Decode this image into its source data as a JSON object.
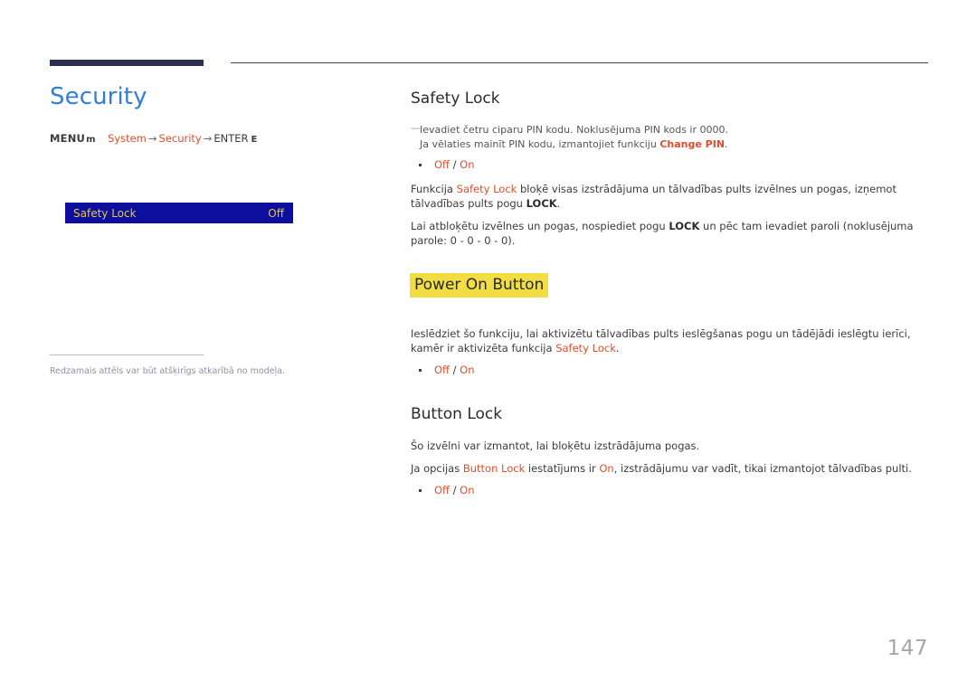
{
  "page": {
    "number": "147",
    "title": "Security",
    "accent_color": "#e24d2c",
    "title_color": "#2f7fd8",
    "highlight_color": "#f2dd43",
    "rule_color": "#2b3050"
  },
  "menu_path": {
    "menu_label": "MENU",
    "menu_glyph": "m",
    "step1": "System",
    "arrow1": "→",
    "step2": "Security",
    "arrow2": "→",
    "enter_label": "ENTER",
    "enter_glyph": "E"
  },
  "osd_preview": {
    "label": "Safety Lock",
    "value": "Off",
    "background": "#0d0d9e",
    "text_color": "#e8c93a"
  },
  "left_footnote": {
    "text": "Redzamais attēls var būt atšķirīgs atkarībā no modeļa."
  },
  "sections": [
    {
      "heading": "Safety Lock",
      "highlighted": false,
      "note": {
        "dash": "—",
        "line1_a": "Ievadiet četru ciparu PIN kodu. Noklusējuma PIN kods ir 0000.",
        "line2_a": "Ja vēlaties mainīt PIN kodu, izmantojiet funkciju ",
        "line2_accent": "Change PIN",
        "line2_b": "."
      },
      "options": {
        "off": "Off",
        "slash": " / ",
        "on": "On"
      },
      "paragraphs": [
        {
          "p1_a": "Funkcija ",
          "p1_accent": "Safety Lock",
          "p1_b": " bloķē visas izstrādājuma un tālvadības pults izvēlnes un pogas, izņemot tālvadības pults pogu ",
          "p1_bold": "LOCK",
          "p1_c": "."
        },
        {
          "p2_a": "Lai atbloķētu izvēlnes un pogas, nospiediet pogu ",
          "p2_bold": "LOCK",
          "p2_b": " un pēc tam ievadiet paroli (noklusējuma parole: 0 - 0 - 0 - 0)."
        }
      ]
    },
    {
      "heading": "Power On Button",
      "highlighted": true,
      "paragraph": {
        "a": "Ieslēdziet šo funkciju, lai aktivizētu tālvadības pults ieslēgšanas pogu un tādējādi ieslēgtu ierīci, kamēr ir aktivizēta funkcija ",
        "accent": "Safety Lock",
        "b": "."
      },
      "options": {
        "off": "Off",
        "slash": " / ",
        "on": "On"
      }
    },
    {
      "heading": "Button Lock",
      "highlighted": false,
      "paragraphs": [
        {
          "text": "Šo izvēlni var izmantot, lai bloķētu izstrādājuma pogas."
        }
      ],
      "paragraph2": {
        "a": "Ja opcijas ",
        "accent1": "Button Lock",
        "b": " iestatījums ir ",
        "accent2": "On",
        "c": ", izstrādājumu var vadīt, tikai izmantojot tālvadības pulti."
      },
      "options": {
        "off": "Off",
        "slash": " / ",
        "on": "On"
      }
    }
  ]
}
